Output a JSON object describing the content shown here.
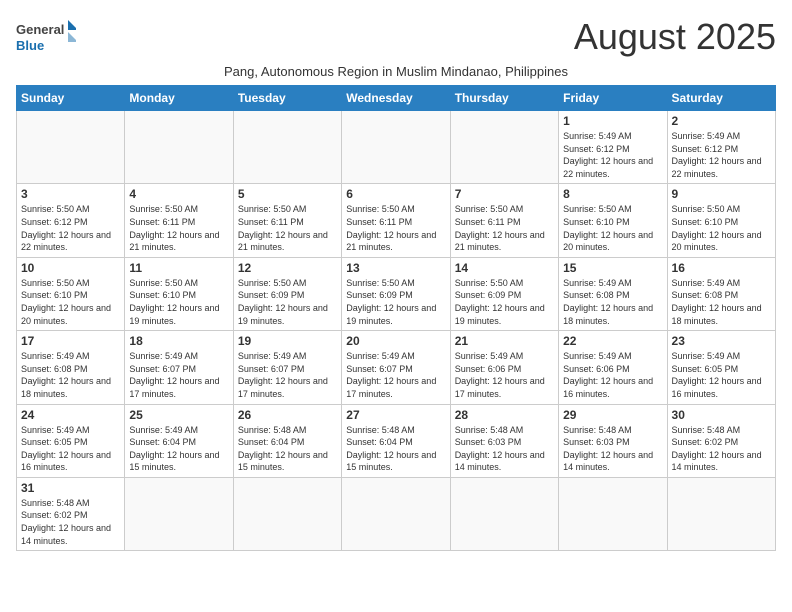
{
  "logo": {
    "text_general": "General",
    "text_blue": "Blue"
  },
  "title": "August 2025",
  "subtitle": "Pang, Autonomous Region in Muslim Mindanao, Philippines",
  "weekdays": [
    "Sunday",
    "Monday",
    "Tuesday",
    "Wednesday",
    "Thursday",
    "Friday",
    "Saturday"
  ],
  "weeks": [
    [
      {
        "day": "",
        "info": ""
      },
      {
        "day": "",
        "info": ""
      },
      {
        "day": "",
        "info": ""
      },
      {
        "day": "",
        "info": ""
      },
      {
        "day": "",
        "info": ""
      },
      {
        "day": "1",
        "info": "Sunrise: 5:49 AM\nSunset: 6:12 PM\nDaylight: 12 hours and 22 minutes."
      },
      {
        "day": "2",
        "info": "Sunrise: 5:49 AM\nSunset: 6:12 PM\nDaylight: 12 hours and 22 minutes."
      }
    ],
    [
      {
        "day": "3",
        "info": "Sunrise: 5:50 AM\nSunset: 6:12 PM\nDaylight: 12 hours and 22 minutes."
      },
      {
        "day": "4",
        "info": "Sunrise: 5:50 AM\nSunset: 6:11 PM\nDaylight: 12 hours and 21 minutes."
      },
      {
        "day": "5",
        "info": "Sunrise: 5:50 AM\nSunset: 6:11 PM\nDaylight: 12 hours and 21 minutes."
      },
      {
        "day": "6",
        "info": "Sunrise: 5:50 AM\nSunset: 6:11 PM\nDaylight: 12 hours and 21 minutes."
      },
      {
        "day": "7",
        "info": "Sunrise: 5:50 AM\nSunset: 6:11 PM\nDaylight: 12 hours and 21 minutes."
      },
      {
        "day": "8",
        "info": "Sunrise: 5:50 AM\nSunset: 6:10 PM\nDaylight: 12 hours and 20 minutes."
      },
      {
        "day": "9",
        "info": "Sunrise: 5:50 AM\nSunset: 6:10 PM\nDaylight: 12 hours and 20 minutes."
      }
    ],
    [
      {
        "day": "10",
        "info": "Sunrise: 5:50 AM\nSunset: 6:10 PM\nDaylight: 12 hours and 20 minutes."
      },
      {
        "day": "11",
        "info": "Sunrise: 5:50 AM\nSunset: 6:10 PM\nDaylight: 12 hours and 19 minutes."
      },
      {
        "day": "12",
        "info": "Sunrise: 5:50 AM\nSunset: 6:09 PM\nDaylight: 12 hours and 19 minutes."
      },
      {
        "day": "13",
        "info": "Sunrise: 5:50 AM\nSunset: 6:09 PM\nDaylight: 12 hours and 19 minutes."
      },
      {
        "day": "14",
        "info": "Sunrise: 5:50 AM\nSunset: 6:09 PM\nDaylight: 12 hours and 19 minutes."
      },
      {
        "day": "15",
        "info": "Sunrise: 5:49 AM\nSunset: 6:08 PM\nDaylight: 12 hours and 18 minutes."
      },
      {
        "day": "16",
        "info": "Sunrise: 5:49 AM\nSunset: 6:08 PM\nDaylight: 12 hours and 18 minutes."
      }
    ],
    [
      {
        "day": "17",
        "info": "Sunrise: 5:49 AM\nSunset: 6:08 PM\nDaylight: 12 hours and 18 minutes."
      },
      {
        "day": "18",
        "info": "Sunrise: 5:49 AM\nSunset: 6:07 PM\nDaylight: 12 hours and 17 minutes."
      },
      {
        "day": "19",
        "info": "Sunrise: 5:49 AM\nSunset: 6:07 PM\nDaylight: 12 hours and 17 minutes."
      },
      {
        "day": "20",
        "info": "Sunrise: 5:49 AM\nSunset: 6:07 PM\nDaylight: 12 hours and 17 minutes."
      },
      {
        "day": "21",
        "info": "Sunrise: 5:49 AM\nSunset: 6:06 PM\nDaylight: 12 hours and 17 minutes."
      },
      {
        "day": "22",
        "info": "Sunrise: 5:49 AM\nSunset: 6:06 PM\nDaylight: 12 hours and 16 minutes."
      },
      {
        "day": "23",
        "info": "Sunrise: 5:49 AM\nSunset: 6:05 PM\nDaylight: 12 hours and 16 minutes."
      }
    ],
    [
      {
        "day": "24",
        "info": "Sunrise: 5:49 AM\nSunset: 6:05 PM\nDaylight: 12 hours and 16 minutes."
      },
      {
        "day": "25",
        "info": "Sunrise: 5:49 AM\nSunset: 6:04 PM\nDaylight: 12 hours and 15 minutes."
      },
      {
        "day": "26",
        "info": "Sunrise: 5:48 AM\nSunset: 6:04 PM\nDaylight: 12 hours and 15 minutes."
      },
      {
        "day": "27",
        "info": "Sunrise: 5:48 AM\nSunset: 6:04 PM\nDaylight: 12 hours and 15 minutes."
      },
      {
        "day": "28",
        "info": "Sunrise: 5:48 AM\nSunset: 6:03 PM\nDaylight: 12 hours and 14 minutes."
      },
      {
        "day": "29",
        "info": "Sunrise: 5:48 AM\nSunset: 6:03 PM\nDaylight: 12 hours and 14 minutes."
      },
      {
        "day": "30",
        "info": "Sunrise: 5:48 AM\nSunset: 6:02 PM\nDaylight: 12 hours and 14 minutes."
      }
    ],
    [
      {
        "day": "31",
        "info": "Sunrise: 5:48 AM\nSunset: 6:02 PM\nDaylight: 12 hours and 14 minutes."
      },
      {
        "day": "",
        "info": ""
      },
      {
        "day": "",
        "info": ""
      },
      {
        "day": "",
        "info": ""
      },
      {
        "day": "",
        "info": ""
      },
      {
        "day": "",
        "info": ""
      },
      {
        "day": "",
        "info": ""
      }
    ]
  ]
}
